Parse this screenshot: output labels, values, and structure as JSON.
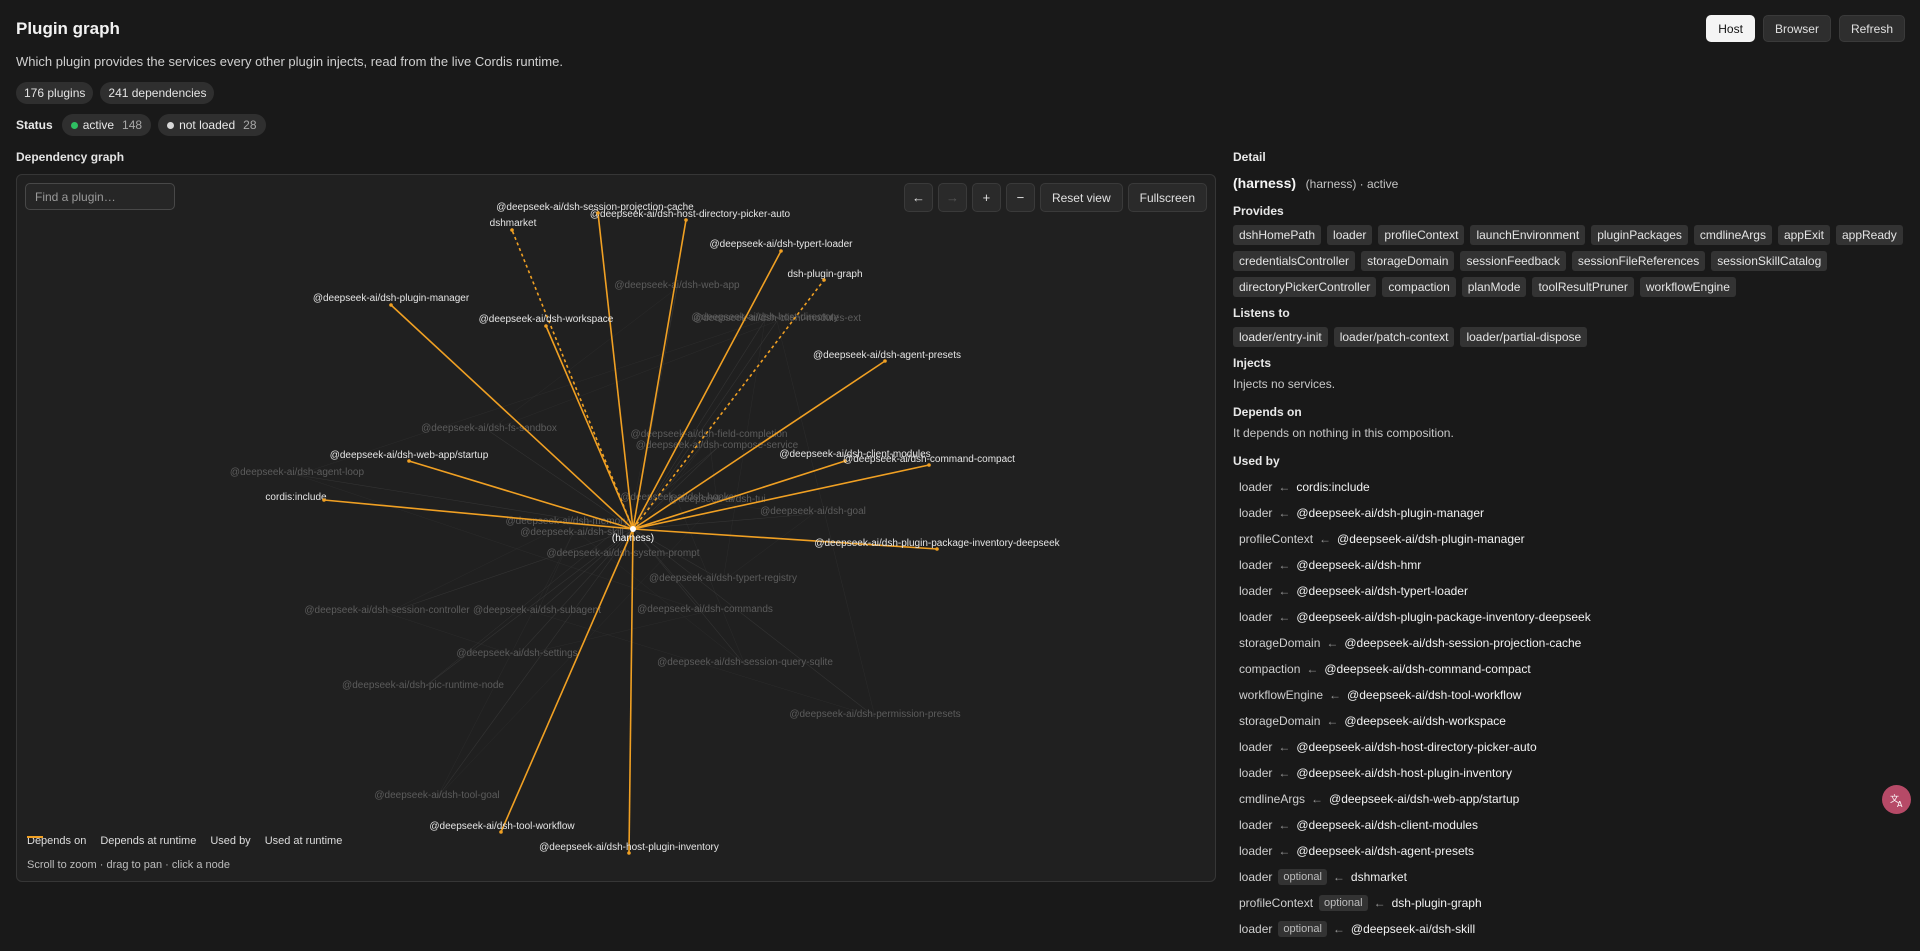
{
  "header": {
    "title": "Plugin graph",
    "subtitle": "Which plugin provides the services every other plugin injects, read from the live Cordis runtime.",
    "buttons": {
      "host": "Host",
      "browser": "Browser",
      "refresh": "Refresh"
    }
  },
  "stats": {
    "plugins": "176 plugins",
    "dependencies": "241 dependencies"
  },
  "status": {
    "label": "Status",
    "active": {
      "label": "active",
      "count": "148",
      "color": "#2fbf62"
    },
    "not_loaded": {
      "label": "not loaded",
      "count": "28",
      "color": "#d8d8d8"
    }
  },
  "graph": {
    "heading": "Dependency graph",
    "search_placeholder": "Find a plugin…",
    "controls": {
      "back": "←",
      "forward": "→",
      "zoom_in": "+",
      "zoom_out": "−",
      "reset": "Reset view",
      "fullscreen": "Fullscreen"
    },
    "legend": {
      "depends_on": "Depends on",
      "depends_runtime": "Depends at runtime",
      "used_by": "Used by",
      "used_runtime": "Used at runtime"
    },
    "hint": "Scroll to zoom · drag to pan · click a node",
    "colors": {
      "used": "#f0a023",
      "depends": "#f2f2f2",
      "faint": "#5a5a5a"
    },
    "center_node": "(harness)",
    "highlighted_nodes": [
      "@deepseek-ai/dsh-host-directory-picker-auto",
      "@deepseek-ai/dsh-session-projection-cache",
      "dshmarket",
      "@deepseek-ai/dsh-typert-loader",
      "dsh-plugin-graph",
      "@deepseek-ai/dsh-plugin-manager",
      "@deepseek-ai/dsh-workspace",
      "@deepseek-ai/dsh-agent-presets",
      "@deepseek-ai/dsh-client-modules",
      "@deepseek-ai/dsh-command-compact",
      "@deepseek-ai/dsh-web-app/startup",
      "cordis:include",
      "@deepseek-ai/dsh-plugin-package-inventory-deepseek",
      "@deepseek-ai/dsh-tool-workflow",
      "@deepseek-ai/dsh-host-plugin-inventory"
    ],
    "faint_nodes": [
      "@deepseek-ai/dsh-web-app",
      "@deepseek-ai/dsh-host-directory",
      "@deepseek-ai/dsh-client-modules-ext",
      "@deepseek-ai/dsh-fs-sandbox",
      "@deepseek-ai/dsh-field-completion",
      "@deepseek-ai/dsh-compose-service",
      "@deepseek-ai/dsh-agent-loop",
      "@deepseek-ai/dsh-goal",
      "@deepseek-ai/dsh-hooks",
      "@deepseek-ai/dsh-system-prompt",
      "@deepseek-ai/dsh-typert-registry",
      "@deepseek-ai/dsh-session-controller",
      "@deepseek-ai/dsh-subagent",
      "@deepseek-ai/dsh-commands",
      "@deepseek-ai/dsh-settings",
      "@deepseek-ai/dsh-session-query-sqlite",
      "@deepseek-ai/dsh-pic-runtime-node",
      "@deepseek-ai/dsh-permission-presets",
      "@deepseek-ai/dsh-tool-goal",
      "@deepseek-ai/dsh-tui",
      "@deepseek-ai/dsh-memory",
      "@deepseek-ai/dsh-skill"
    ]
  },
  "detail": {
    "heading": "Detail",
    "name": "(harness)",
    "meta": "(harness) · active",
    "provides_heading": "Provides",
    "provides": [
      "dshHomePath",
      "loader",
      "profileContext",
      "launchEnvironment",
      "pluginPackages",
      "cmdlineArgs",
      "appExit",
      "appReady",
      "credentialsController",
      "storageDomain",
      "sessionFeedback",
      "sessionFileReferences",
      "sessionSkillCatalog",
      "directoryPickerController",
      "compaction",
      "planMode",
      "toolResultPruner",
      "workflowEngine"
    ],
    "listens_heading": "Listens to",
    "listens": [
      "loader/entry-init",
      "loader/patch-context",
      "loader/partial-dispose"
    ],
    "injects_heading": "Injects",
    "injects_text": "Injects no services.",
    "depends_heading": "Depends on",
    "depends_text": "It depends on nothing in this composition.",
    "used_by_heading": "Used by",
    "arrow": "←",
    "optional_label": "optional",
    "used_by": [
      {
        "service": "loader",
        "source": "cordis:include",
        "optional": false
      },
      {
        "service": "loader",
        "source": "@deepseek-ai/dsh-plugin-manager",
        "optional": false
      },
      {
        "service": "profileContext",
        "source": "@deepseek-ai/dsh-plugin-manager",
        "optional": false
      },
      {
        "service": "loader",
        "source": "@deepseek-ai/dsh-hmr",
        "optional": false
      },
      {
        "service": "loader",
        "source": "@deepseek-ai/dsh-typert-loader",
        "optional": false
      },
      {
        "service": "loader",
        "source": "@deepseek-ai/dsh-plugin-package-inventory-deepseek",
        "optional": false
      },
      {
        "service": "storageDomain",
        "source": "@deepseek-ai/dsh-session-projection-cache",
        "optional": false
      },
      {
        "service": "compaction",
        "source": "@deepseek-ai/dsh-command-compact",
        "optional": false
      },
      {
        "service": "workflowEngine",
        "source": "@deepseek-ai/dsh-tool-workflow",
        "optional": false
      },
      {
        "service": "storageDomain",
        "source": "@deepseek-ai/dsh-workspace",
        "optional": false
      },
      {
        "service": "loader",
        "source": "@deepseek-ai/dsh-host-directory-picker-auto",
        "optional": false
      },
      {
        "service": "loader",
        "source": "@deepseek-ai/dsh-host-plugin-inventory",
        "optional": false
      },
      {
        "service": "cmdlineArgs",
        "source": "@deepseek-ai/dsh-web-app/startup",
        "optional": false
      },
      {
        "service": "loader",
        "source": "@deepseek-ai/dsh-client-modules",
        "optional": false
      },
      {
        "service": "loader",
        "source": "@deepseek-ai/dsh-agent-presets",
        "optional": false
      },
      {
        "service": "loader",
        "source": "dshmarket",
        "optional": true
      },
      {
        "service": "profileContext",
        "source": "dsh-plugin-graph",
        "optional": true
      },
      {
        "service": "loader",
        "source": "@deepseek-ai/dsh-skill",
        "optional": true
      }
    ]
  },
  "fab": {
    "icon": "translate-icon"
  }
}
